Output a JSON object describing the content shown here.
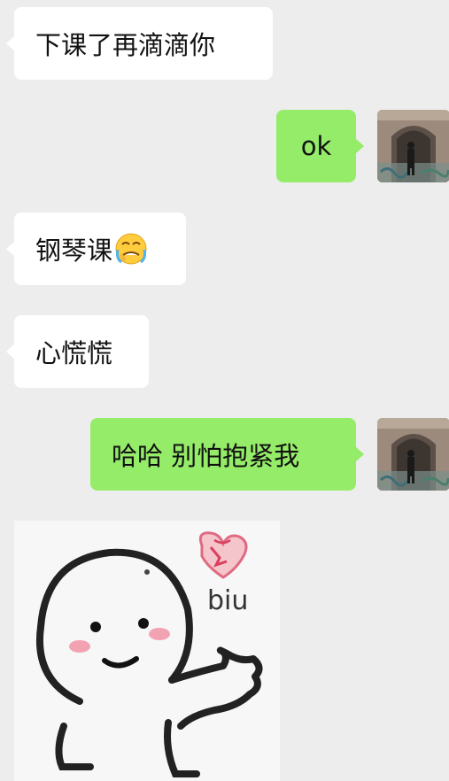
{
  "messages": [
    {
      "side": "in",
      "text": "下课了再滴滴你"
    },
    {
      "side": "out",
      "text": "ok"
    },
    {
      "side": "in",
      "text": "钢琴课",
      "emoji": "crying-face-covering-eyes"
    },
    {
      "side": "in",
      "text": "心慌慌"
    },
    {
      "side": "out",
      "text": "哈哈 别怕抱紧我"
    }
  ],
  "sticker": {
    "caption": "biu",
    "icon": "heart-sticker"
  },
  "colors": {
    "background": "#ededed",
    "incoming_bubble": "#ffffff",
    "outgoing_bubble": "#95ec69"
  }
}
